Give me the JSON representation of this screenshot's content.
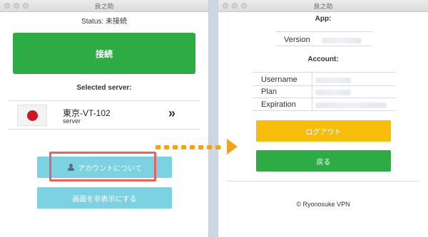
{
  "left_window": {
    "title": "良之助",
    "status": "Status: 未接続",
    "connect_label": "接続",
    "selected_server_label": "Selected server:",
    "server": {
      "name": "東京-VT-102",
      "sub": "server",
      "flag": "japan-flag-icon",
      "action_icon": "double-chevron-right-icon",
      "action_glyph": "»"
    },
    "account_button_label": "アカウントについて",
    "hide_button_label": "画面を非表示にする"
  },
  "right_window": {
    "title": "良之助",
    "app_heading": "App:",
    "version_label": "Version",
    "account_heading": "Account:",
    "account_rows": [
      {
        "label": "Username"
      },
      {
        "label": "Plan"
      },
      {
        "label": "Expiration"
      }
    ],
    "logout_label": "ログアウト",
    "back_label": "戻る",
    "footer": "© Ryonosuke VPN"
  },
  "colors": {
    "connect_green": "#2eab45",
    "account_blue": "#7cd2e0",
    "highlight_red": "#e36560",
    "logout_yellow": "#f8bd0b",
    "arrow_orange": "#f0a31c"
  }
}
